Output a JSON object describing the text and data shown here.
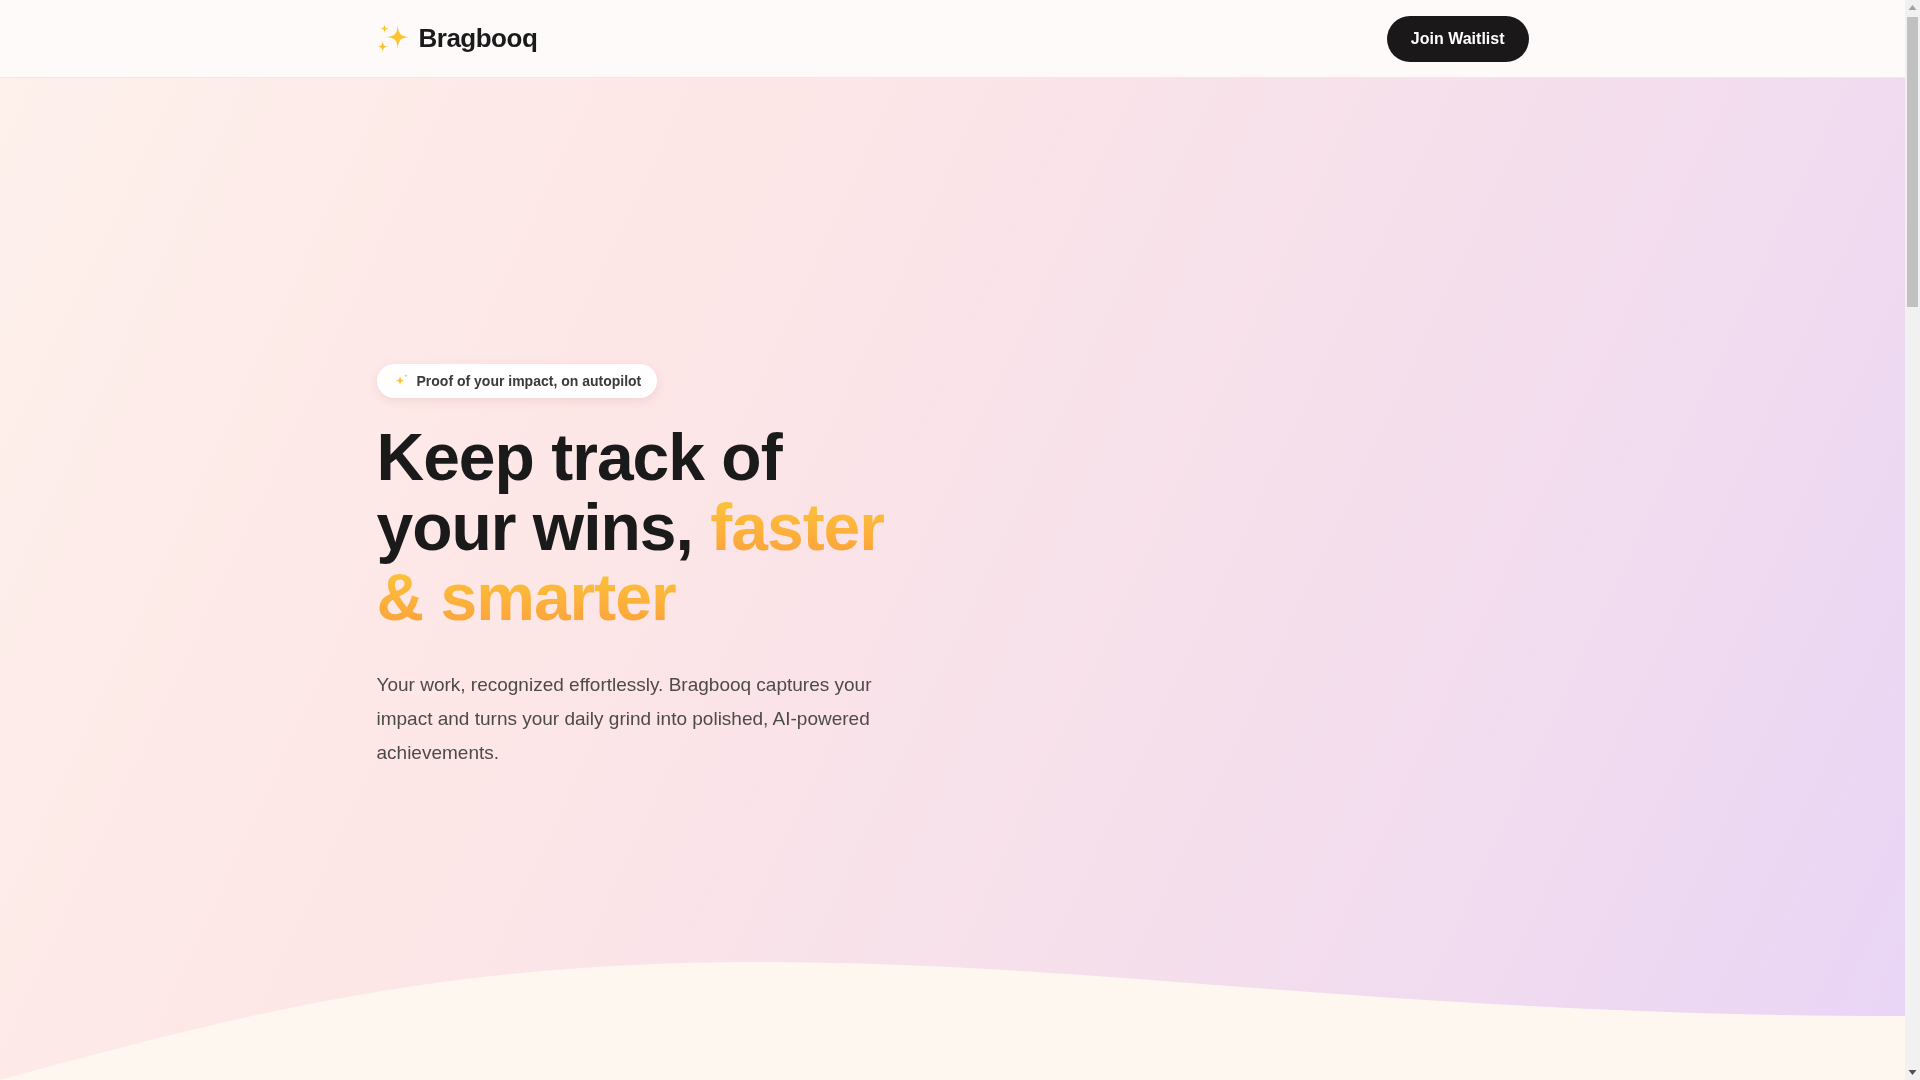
{
  "header": {
    "brand": "Bragbooq",
    "cta": "Join Waitlist"
  },
  "hero": {
    "badge": "Proof of your impact, on autopilot",
    "heading": {
      "plain": "Keep track of your wins,",
      "highlight": "faster & smarter"
    },
    "description": "Your work, recognized effortlessly. Bragbooq captures your impact and turns your daily grind into polished, AI-powered achievements."
  }
}
